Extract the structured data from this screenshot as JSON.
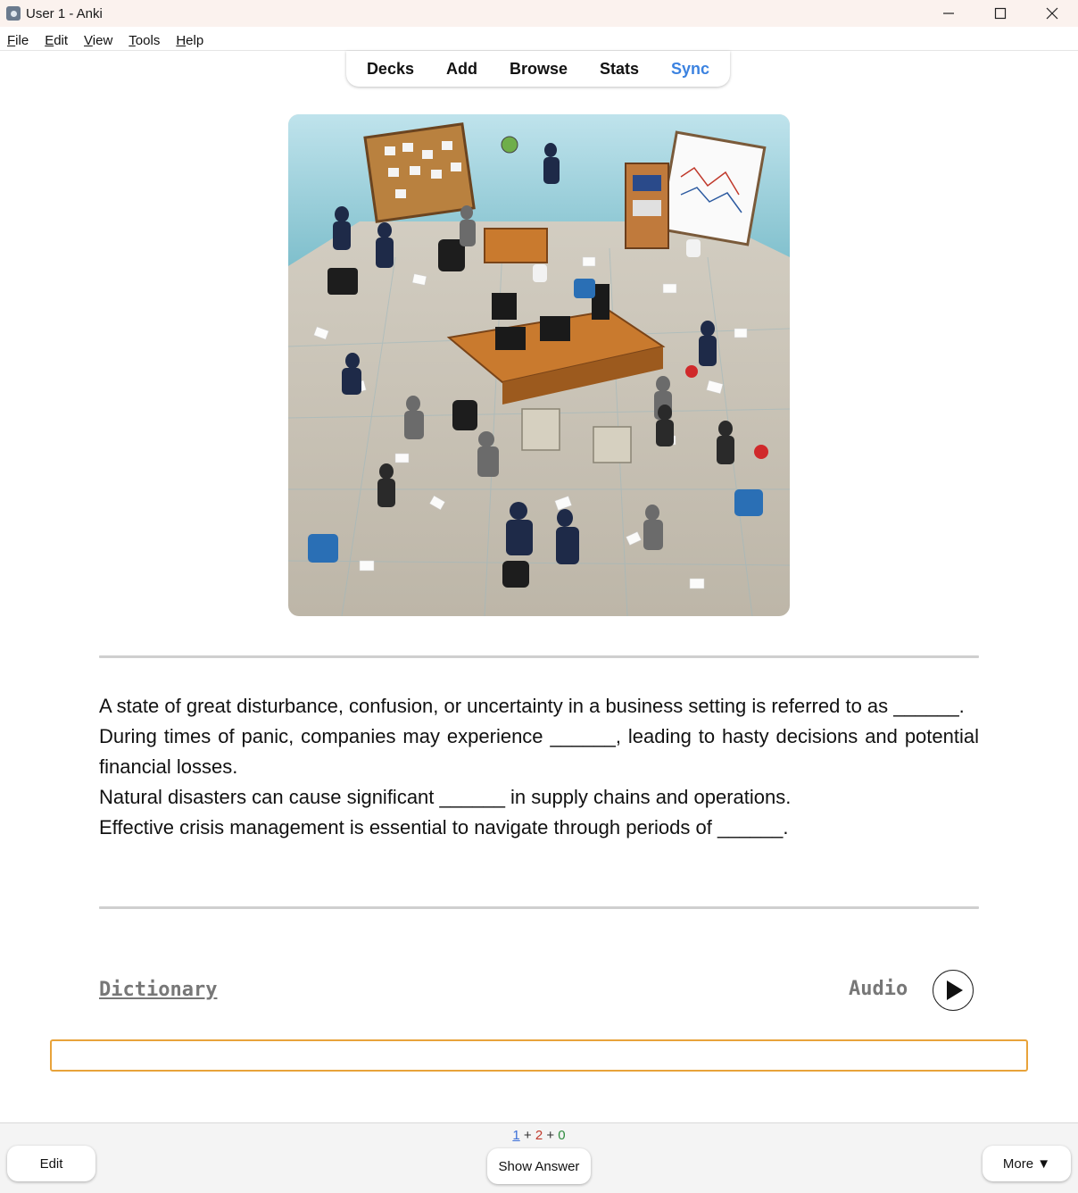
{
  "window": {
    "title": "User 1 - Anki",
    "controls": {
      "minimize": "minimize-icon",
      "maximize": "maximize-icon",
      "close": "close-icon"
    }
  },
  "menu": [
    {
      "ul": "F",
      "rest": "ile"
    },
    {
      "ul": "E",
      "rest": "dit"
    },
    {
      "ul": "V",
      "rest": "iew"
    },
    {
      "ul": "T",
      "rest": "ools"
    },
    {
      "ul": "H",
      "rest": "elp"
    }
  ],
  "toolbar": {
    "decks": "Decks",
    "add": "Add",
    "browse": "Browse",
    "stats": "Stats",
    "sync": "Sync",
    "sync_color": "#3b82e0"
  },
  "card": {
    "image_icon": "chaotic-office-image",
    "lines": [
      "A state of great disturbance, confusion, or uncertainty in a business setting is referred to as ______.",
      "During times of panic, companies may experience ______, leading to hasty decisions and potential financial losses.",
      "Natural disasters can cause significant ______ in supply chains and operations.",
      "Effective crisis management is essential to navigate through periods of ______."
    ],
    "dictionary": "Dictionary",
    "audio": "Audio",
    "answer_value": ""
  },
  "bottom": {
    "count_new": "1",
    "count_learn": "2",
    "count_review": "0",
    "sep": "+",
    "edit": "Edit",
    "show_answer": "Show Answer",
    "more": "More ▼",
    "answer_border_color": "#e8a33a"
  }
}
